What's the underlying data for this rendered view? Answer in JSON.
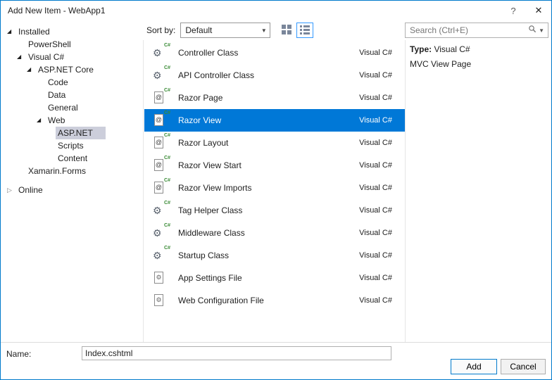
{
  "window": {
    "title": "Add New Item - WebApp1",
    "help_glyph": "?",
    "close_glyph": "✕"
  },
  "toolbar": {
    "sort_label": "Sort by:",
    "sort_value": "Default",
    "search_placeholder": "Search (Ctrl+E)"
  },
  "tree": {
    "items": [
      {
        "label": "Installed",
        "depth": 0,
        "expander": "expanded",
        "selected": false,
        "gap": false
      },
      {
        "label": "PowerShell",
        "depth": 1,
        "expander": null,
        "selected": false,
        "gap": false
      },
      {
        "label": "Visual C#",
        "depth": 1,
        "expander": "expanded",
        "selected": false,
        "gap": false
      },
      {
        "label": "ASP.NET Core",
        "depth": 2,
        "expander": "expanded",
        "selected": false,
        "gap": false
      },
      {
        "label": "Code",
        "depth": 3,
        "expander": null,
        "selected": false,
        "gap": false
      },
      {
        "label": "Data",
        "depth": 3,
        "expander": null,
        "selected": false,
        "gap": false
      },
      {
        "label": "General",
        "depth": 3,
        "expander": null,
        "selected": false,
        "gap": false
      },
      {
        "label": "Web",
        "depth": 3,
        "expander": "expanded",
        "selected": false,
        "gap": false
      },
      {
        "label": "ASP.NET",
        "depth": 4,
        "expander": null,
        "selected": true,
        "gap": false
      },
      {
        "label": "Scripts",
        "depth": 4,
        "expander": null,
        "selected": false,
        "gap": false
      },
      {
        "label": "Content",
        "depth": 4,
        "expander": null,
        "selected": false,
        "gap": false
      },
      {
        "label": "Xamarin.Forms",
        "depth": 1,
        "expander": null,
        "selected": false,
        "gap": false
      },
      {
        "label": "Online",
        "depth": 0,
        "expander": "collapsed",
        "selected": false,
        "gap": true
      }
    ]
  },
  "templates": {
    "items": [
      {
        "name": "Controller Class",
        "lang": "Visual C#",
        "icon": "csharp-class",
        "selected": false
      },
      {
        "name": "API Controller Class",
        "lang": "Visual C#",
        "icon": "csharp-class",
        "selected": false
      },
      {
        "name": "Razor Page",
        "lang": "Visual C#",
        "icon": "razor-file",
        "selected": false
      },
      {
        "name": "Razor View",
        "lang": "Visual C#",
        "icon": "razor-file",
        "selected": true
      },
      {
        "name": "Razor Layout",
        "lang": "Visual C#",
        "icon": "razor-file",
        "selected": false
      },
      {
        "name": "Razor View Start",
        "lang": "Visual C#",
        "icon": "razor-file",
        "selected": false
      },
      {
        "name": "Razor View Imports",
        "lang": "Visual C#",
        "icon": "razor-file",
        "selected": false
      },
      {
        "name": "Tag Helper Class",
        "lang": "Visual C#",
        "icon": "csharp-class",
        "selected": false
      },
      {
        "name": "Middleware Class",
        "lang": "Visual C#",
        "icon": "csharp-class",
        "selected": false
      },
      {
        "name": "Startup Class",
        "lang": "Visual C#",
        "icon": "csharp-class",
        "selected": false
      },
      {
        "name": "App Settings File",
        "lang": "Visual C#",
        "icon": "app-settings-file",
        "selected": false
      },
      {
        "name": "Web Configuration File",
        "lang": "Visual C#",
        "icon": "web-config-file",
        "selected": false
      }
    ]
  },
  "details": {
    "type_label": "Type:",
    "type_value": "Visual C#",
    "description": "MVC View Page"
  },
  "footer": {
    "name_label": "Name:",
    "name_value": "Index.cshtml",
    "add_label": "Add",
    "cancel_label": "Cancel"
  },
  "colors": {
    "accent": "#007acc",
    "list_selection": "#0078d7",
    "tree_selection": "#cccedb",
    "csharp_green": "#388a34"
  }
}
